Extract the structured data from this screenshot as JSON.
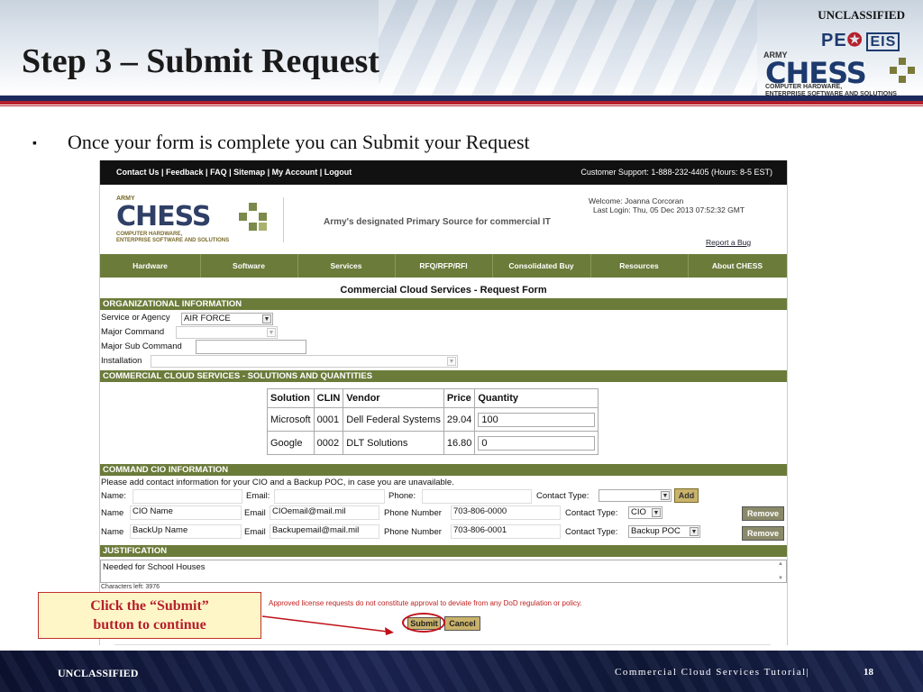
{
  "slide": {
    "classification_top": "UNCLASSIFIED",
    "title": "Step 3 – Submit Request",
    "bullet": "Once your form is complete you can Submit your Request",
    "callout_line1": "Click the “Submit”",
    "callout_line2": "button to continue",
    "footer_classification": "UNCLASSIFIED",
    "footer_title": "Commercial Cloud Services Tutorial|",
    "page_number": "18",
    "logo_peo": "PE",
    "logo_eis": "EIS",
    "logo_army": "ARMY",
    "logo_chess": "CHESS",
    "logo_sub1": "COMPUTER HARDWARE,",
    "logo_sub2": "ENTERPRISE SOFTWARE AND SOLUTIONS"
  },
  "site": {
    "top_links": "Contact Us | Feedback | FAQ | Sitemap | My Account | Logout",
    "support": "Customer Support: 1-888-232-4405 (Hours: 8-5 EST)",
    "logo_army": "ARMY",
    "logo_chess": "CHESS",
    "logo_sub1": "COMPUTER HARDWARE,",
    "logo_sub2": "ENTERPRISE SOFTWARE AND SOLUTIONS",
    "tagline": "Army's designated Primary Source for commercial IT",
    "welcome": "Welcome: Joanna Corcoran",
    "last_login": "Last Login: Thu, 05 Dec 2013 07:52:32 GMT",
    "report_bug": "Report a Bug",
    "nav": [
      "Hardware",
      "Software",
      "Services",
      "RFQ/RFP/RFI",
      "Consolidated Buy",
      "Resources",
      "About CHESS"
    ]
  },
  "form": {
    "title": "Commercial Cloud Services - Request Form",
    "org_section": "ORGANIZATIONAL INFORMATION",
    "service_label": "Service or Agency",
    "service_value": "AIR FORCE",
    "major_command_label": "Major Command",
    "major_command_value": "",
    "sub_command_label": "Major Sub Command",
    "sub_command_value": "",
    "installation_label": "Installation",
    "installation_value": "",
    "solutions_section": "COMMERCIAL CLOUD SERVICES - SOLUTIONS AND QUANTITIES",
    "table_headers": [
      "Solution",
      "CLIN",
      "Vendor",
      "Price",
      "Quantity"
    ],
    "rows": [
      {
        "solution": "Microsoft",
        "clin": "0001",
        "vendor": "Dell Federal Systems",
        "price": "29.04",
        "quantity": "100"
      },
      {
        "solution": "Google",
        "clin": "0002",
        "vendor": "DLT Solutions",
        "price": "16.80",
        "quantity": "0"
      }
    ],
    "cio_section": "COMMAND CIO INFORMATION",
    "cio_instructions": "Please add contact information for your CIO and a Backup POC, in case you are unavailable.",
    "new_name_label": "Name:",
    "new_email_label": "Email:",
    "new_phone_label": "Phone:",
    "new_type_label": "Contact Type:",
    "add_label": "Add",
    "contacts": [
      {
        "name_label": "Name",
        "name": "CIO Name",
        "email_label": "Email",
        "email": "CIOemail@mail.mil",
        "phone_label": "Phone Number",
        "phone": "703-806-0000",
        "type_label": "Contact Type:",
        "type": "CIO",
        "remove": "Remove"
      },
      {
        "name_label": "Name",
        "name": "BackUp Name",
        "email_label": "Email",
        "email": "Backupemail@mail.mil",
        "phone_label": "Phone Number",
        "phone": "703-806-0001",
        "type_label": "Contact Type:",
        "type": "Backup POC",
        "remove": "Remove"
      }
    ],
    "justification_section": "JUSTIFICATION",
    "justification_text": "Needed for School Houses",
    "chars_left": "Characters left: 3976",
    "notice": "Approved license requests do not constitute approval to deviate from any DoD regulation or policy.",
    "submit_label": "Submit",
    "cancel_label": "Cancel"
  }
}
